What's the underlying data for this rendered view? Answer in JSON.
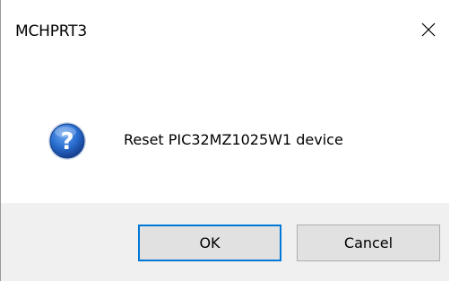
{
  "window": {
    "title": "MCHPRT3",
    "close_icon": "close-icon"
  },
  "message": {
    "icon": "question-icon",
    "text": "Reset PIC32MZ1025W1 device"
  },
  "buttons": {
    "ok_label": "OK",
    "cancel_label": "Cancel"
  },
  "colors": {
    "footer_bg": "#f0f0f0",
    "focus_border": "#0078d7",
    "icon_blue": "#1e5bb8"
  }
}
